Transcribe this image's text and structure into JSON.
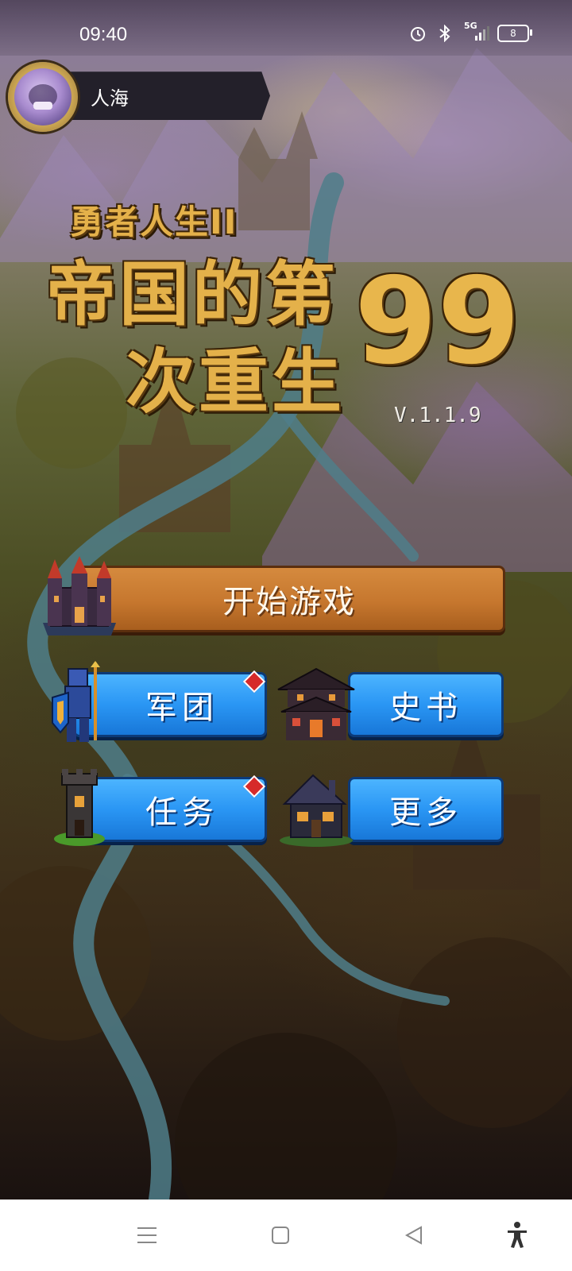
{
  "status_bar": {
    "time": "09:40",
    "icons": [
      "alarm-icon",
      "bluetooth-icon",
      "signal-5g-icon",
      "battery-icon"
    ],
    "network": "5G",
    "battery": "8"
  },
  "player": {
    "name": "人海",
    "avatar": "avatar-image"
  },
  "title": {
    "subtitle": "勇者人生II",
    "line1": "帝国的第",
    "line2": "次重生",
    "number": "99",
    "version": "V.1.1.9"
  },
  "menu": {
    "start": "开始游戏",
    "legion": "军团",
    "history": "史书",
    "tasks": "任务",
    "more": "更多"
  },
  "nav": {
    "icons": [
      "menu-icon",
      "home-icon",
      "back-icon",
      "accessibility-icon"
    ]
  },
  "colors": {
    "start_button": "#c6772e",
    "blue_button": "#2a96f4",
    "title_gold": "#e4b14a",
    "notify_red": "#d62a2a"
  }
}
